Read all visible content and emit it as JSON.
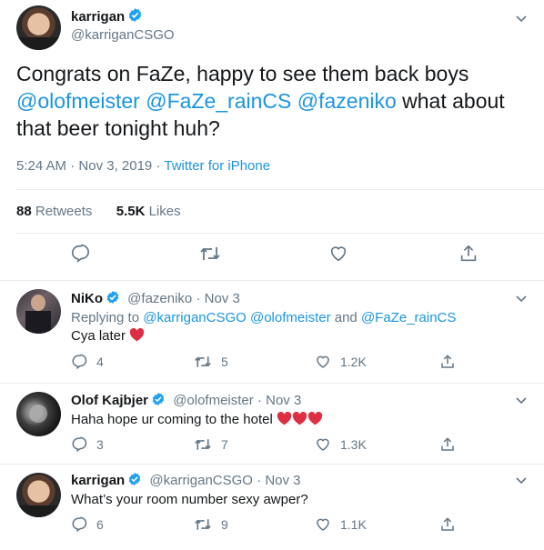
{
  "main_tweet": {
    "name": "karrigan",
    "handle": "@karriganCSGO",
    "text_before": "Congrats on FaZe, happy to see them back boys",
    "mentions": [
      "@olofmeister",
      "@FaZe_rainCS",
      "@fazeniko"
    ],
    "text_after": "what about that beer tonight huh?",
    "time": "5:24 AM",
    "date": "Nov 3, 2019",
    "source": "Twitter for iPhone",
    "retweets_count": "88",
    "retweets_label": "Retweets",
    "likes_count": "5.5K",
    "likes_label": "Likes"
  },
  "replies": [
    {
      "name": "NiKo",
      "handle": "@fazeniko",
      "date": "Nov 3",
      "replying_prefix": "Replying to",
      "replying_to": [
        "@karriganCSGO",
        "@olofmeister"
      ],
      "replying_and": "and",
      "replying_last": "@FaZe_rainCS",
      "text": "Cya later",
      "hearts": 1,
      "reply_count": "4",
      "retweet_count": "5",
      "like_count": "1.2K"
    },
    {
      "name": "Olof Kajbjer",
      "handle": "@olofmeister",
      "date": "Nov 3",
      "text": "Haha hope ur coming to the hotel",
      "hearts": 3,
      "reply_count": "3",
      "retweet_count": "7",
      "like_count": "1.3K"
    },
    {
      "name": "karrigan",
      "handle": "@karriganCSGO",
      "date": "Nov 3",
      "text": "What’s your room number sexy awper?",
      "hearts": 0,
      "reply_count": "6",
      "retweet_count": "9",
      "like_count": "1.1K"
    }
  ],
  "separator": "·",
  "colors": {
    "link": "#1b95e0",
    "secondary": "#657786",
    "verified": "#1da1f2",
    "heart": "#e0245e"
  },
  "icons": [
    "reply-icon",
    "retweet-icon",
    "like-icon",
    "share-icon",
    "verified-icon",
    "chevron-down-icon"
  ]
}
